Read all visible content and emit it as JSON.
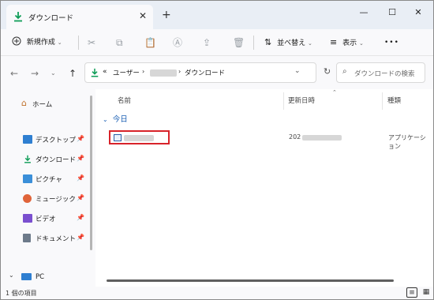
{
  "window": {
    "tab_title": "ダウンロード",
    "tab_close": "✕",
    "new_tab": "+",
    "minimize": "—",
    "maximize": "☐",
    "close": "✕"
  },
  "toolbar": {
    "new_label": "新規作成",
    "sort_label": "並べ替え",
    "view_label": "表示",
    "more_label": "•••"
  },
  "address": {
    "overflow": "«",
    "crumb_user": "ユーザー",
    "crumb_download": "ダウンロード",
    "search_placeholder": "ダウンロードの検索"
  },
  "sidebar": {
    "home": "ホーム",
    "items": [
      {
        "label": "デスクトップ"
      },
      {
        "label": "ダウンロード"
      },
      {
        "label": "ピクチャ"
      },
      {
        "label": "ミュージック"
      },
      {
        "label": "ビデオ"
      },
      {
        "label": "ドキュメント"
      }
    ],
    "pc_label": "PC"
  },
  "content": {
    "col_name": "名前",
    "col_date": "更新日時",
    "col_type": "種類",
    "group_label": "今日",
    "row_date_prefix": "202",
    "row_type": "アプリケーション"
  },
  "status": {
    "item_count": "1 個の項目"
  },
  "colors": {
    "accent": "#1a5fb4",
    "highlight_border": "#d8232a",
    "download_green": "#0f9d58"
  }
}
